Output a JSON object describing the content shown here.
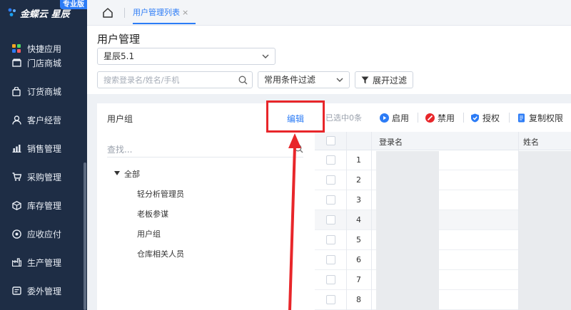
{
  "app": {
    "logo_text": "金蝶云 星辰",
    "edition": "专业版"
  },
  "sidebar": {
    "items": [
      {
        "label": "快捷应用",
        "icon": "apps-grid-icon"
      },
      {
        "label": "门店商城",
        "icon": "store-icon"
      },
      {
        "label": "订货商城",
        "icon": "bag-icon"
      },
      {
        "label": "客户经营",
        "icon": "customer-icon"
      },
      {
        "label": "销售管理",
        "icon": "sales-chart-icon"
      },
      {
        "label": "采购管理",
        "icon": "cart-icon"
      },
      {
        "label": "库存管理",
        "icon": "box-icon"
      },
      {
        "label": "应收应付",
        "icon": "finance-icon"
      },
      {
        "label": "生产管理",
        "icon": "factory-icon"
      },
      {
        "label": "委外管理",
        "icon": "outsource-icon"
      }
    ]
  },
  "tabs": {
    "active_label": "用户管理列表",
    "close_glyph": "×"
  },
  "page": {
    "title": "用户管理",
    "org_value": "星辰5.1"
  },
  "filters": {
    "search_placeholder": "搜索登录名/姓名/手机",
    "common_filter_label": "常用条件过滤",
    "expand_label": "展开过滤"
  },
  "group_panel": {
    "title": "用户组",
    "edit_label": "编辑",
    "search_placeholder": "查找...",
    "tree": {
      "root": "全部",
      "children": [
        "轻分析管理员",
        "老板参谋",
        "用户组",
        "仓库相关人员"
      ]
    }
  },
  "toolbar": {
    "selected_text": "已选中0条",
    "enable_label": "启用",
    "disable_label": "禁用",
    "authorize_label": "授权",
    "copy_perm_label": "复制权限"
  },
  "table": {
    "columns": [
      "登录名",
      "姓名"
    ],
    "row_numbers": [
      "1",
      "2",
      "3",
      "4",
      "5",
      "6",
      "7",
      "8"
    ]
  },
  "colors": {
    "sidebar_bg": "#1e2d45",
    "accent": "#2c7cf6",
    "highlight": "#e8262a"
  }
}
